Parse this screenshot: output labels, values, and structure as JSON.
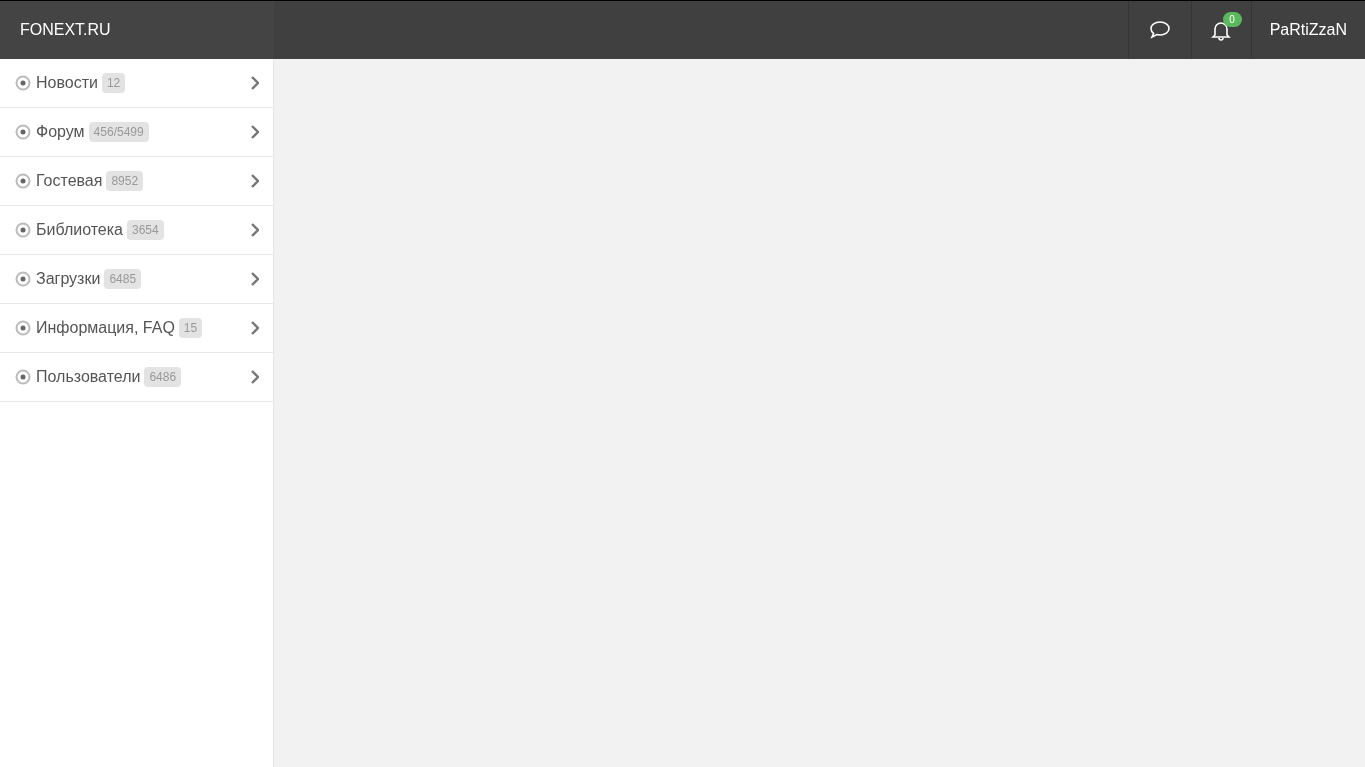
{
  "header": {
    "logo": "FONEXT.RU",
    "notifications_badge": "0",
    "user": "PaRtiZzaN"
  },
  "menu": [
    {
      "label": "Новости",
      "count": "12"
    },
    {
      "label": "Форум",
      "count": "456/5499"
    },
    {
      "label": "Гостевая",
      "count": "8952"
    },
    {
      "label": "Библиотека",
      "count": "3654"
    },
    {
      "label": "Загрузки",
      "count": "6485"
    },
    {
      "label": "Информация, FAQ",
      "count": "15"
    },
    {
      "label": "Пользователи",
      "count": "6486"
    }
  ]
}
